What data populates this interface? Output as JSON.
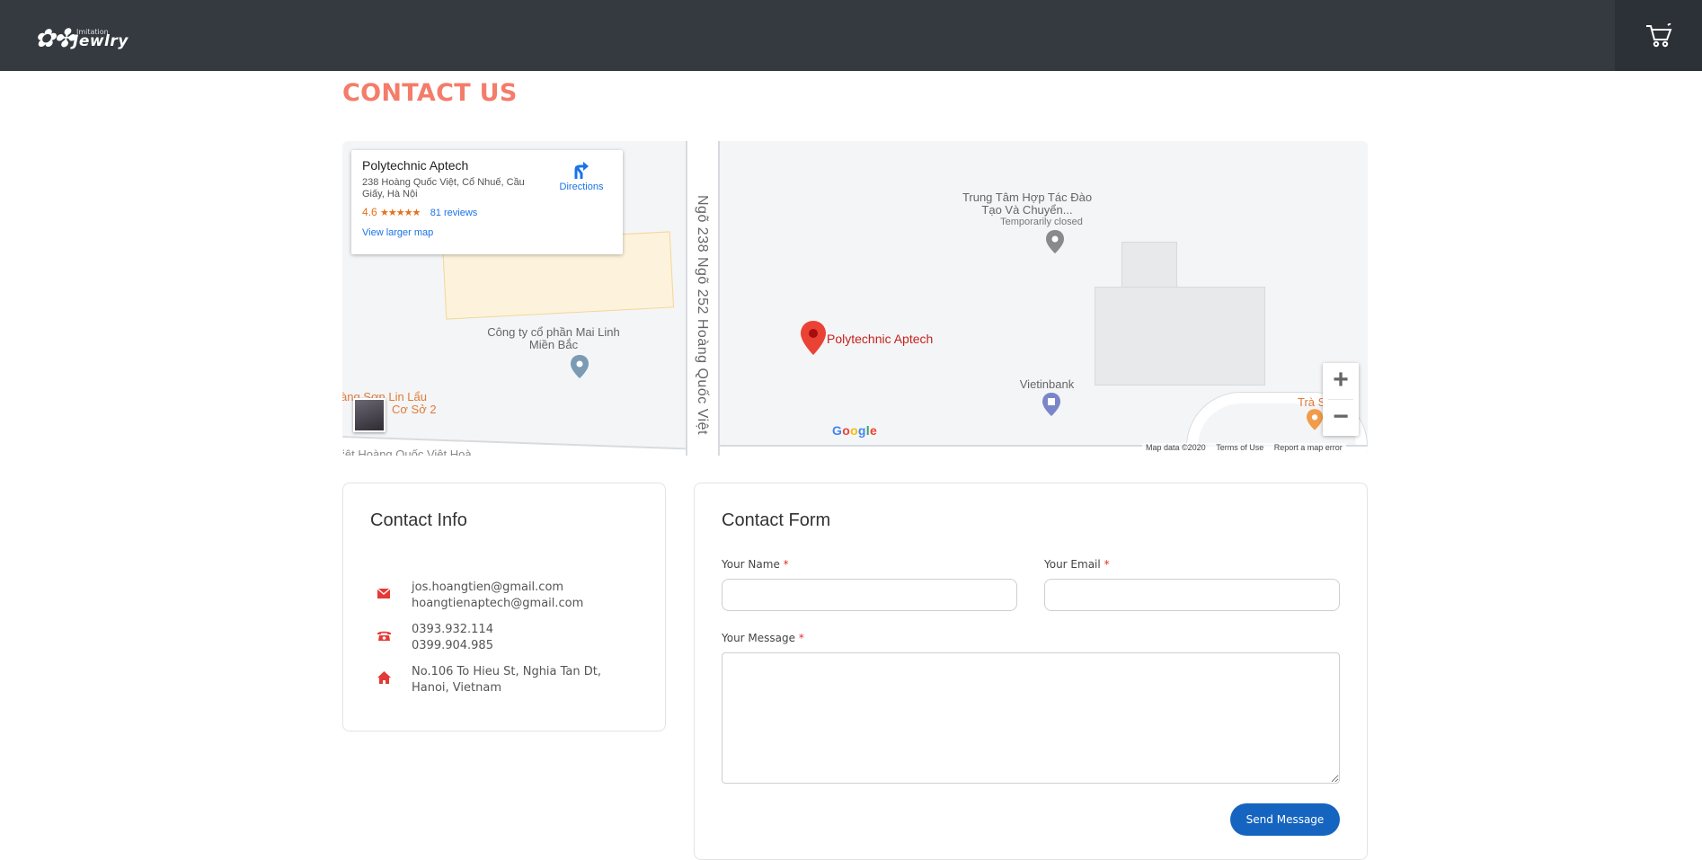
{
  "header": {
    "logo_small": "Imitation",
    "logo_big": "Jewlry",
    "cart_icon": "cart-icon"
  },
  "page": {
    "title": "CONTACT US"
  },
  "map": {
    "place_name": "Polytechnic Aptech",
    "address": "238 Hoàng Quốc Việt, Cổ Nhuế, Cầu Giấy, Hà Nội",
    "rating": "4.6",
    "stars": "★★★★★",
    "reviews": "81 reviews",
    "view_larger": "View larger map",
    "directions": "Directions",
    "labels": {
      "street": "Ngõ 238 Ngõ 252 Hoàng Quốc Việt",
      "mailinh": "Công ty cổ phần Mai Linh Miền Bắc",
      "trungtam": "Trung Tâm Hợp Tác Đào Tạo Và Chuyển...",
      "temp_closed": "Temporarily closed",
      "vietinbank": "Vietinbank",
      "pin_label": "Polytechnic Aptech",
      "son_lin": "àng Sơn Lin Lẩu",
      "coso": "Cơ Sở 2",
      "tra": "Trà S",
      "bottom_road": "iệt    Hoàng Quốc Việt    Hoà"
    },
    "google": "Google",
    "footer": {
      "data": "Map data ©2020",
      "terms": "Terms of Use",
      "report": "Report a map error"
    },
    "zoom_in": "+",
    "zoom_out": "−"
  },
  "contact_info": {
    "title": "Contact Info",
    "email_1": "jos.hoangtien@gmail.com",
    "email_2": "hoangtienaptech@gmail.com",
    "phone_1": "0393.932.114",
    "phone_2": "0399.904.985",
    "address_1": "No.106 To Hieu St, Nghia Tan Dt,",
    "address_2": "Hanoi, Vietnam",
    "icon_color": "#e53935"
  },
  "contact_form": {
    "title": "Contact Form",
    "name_label": "Your Name",
    "email_label": "Your Email",
    "message_label": "Your Message",
    "required_mark": "*",
    "name_value": "",
    "email_value": "",
    "message_value": "",
    "send_label": "Send Message"
  },
  "colors": {
    "header_bg": "#343a40",
    "title": "#f47c6a",
    "button": "#1565c0"
  }
}
